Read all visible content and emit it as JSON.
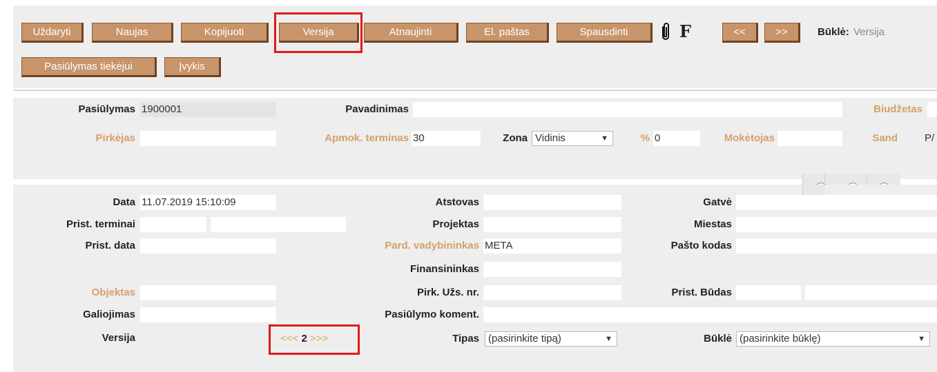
{
  "toolbar": {
    "close": "Uždaryti",
    "new": "Naujas",
    "copy": "Kopijuoti",
    "version": "Versija",
    "refresh": "Atnaujinti",
    "email": "El. paštas",
    "print": "Spausdinti",
    "attach_icon": "paperclip-icon",
    "f_label": "F",
    "prev": "<<",
    "next": ">>",
    "status_label": "Būklė:",
    "status_value": "Versija",
    "supplier_offer": "Pasiūlymas tiekėjui",
    "event": "Įvykis"
  },
  "header": {
    "offer_label": "Pasiūlymas",
    "offer_value": "1900001",
    "name_label": "Pavadinimas",
    "name_value": "",
    "budget_label": "Biudžetas",
    "buyer_label": "Pirkėjas",
    "buyer_value": "",
    "payment_terms_label": "Apmok. terminas",
    "payment_terms_value": "30",
    "zone_label": "Zona",
    "zone_value": "Vidinis",
    "percent_label": "%",
    "percent_value": "0",
    "payer_label": "Mokėtojas",
    "payer_value": "",
    "warehouse_label": "Sand",
    "warehouse_value": "P/"
  },
  "details": {
    "date_label": "Data",
    "date_value": "11.07.2019 15:10:09",
    "delivery_terms_label": "Prist. terminai",
    "delivery_date_label": "Prist. data",
    "object_label": "Objektas",
    "validity_label": "Galiojimas",
    "version_label": "Versija",
    "version_nav_prev": "<<<",
    "version_nav_value": "2",
    "version_nav_next": ">>>",
    "agent_label": "Atstovas",
    "project_label": "Projektas",
    "sales_manager_label": "Pard. vadybininkas",
    "sales_manager_value": "META",
    "financier_label": "Finansininkas",
    "purchase_order_label": "Pirk. Užs. nr.",
    "offer_comment_label": "Pasiūlymo koment.",
    "type_label": "Tipas",
    "type_value": "(pasirinkite tipą)",
    "street_label": "Gatvė",
    "city_label": "Miestas",
    "postcode_label": "Pašto kodas",
    "delivery_method_label": "Prist. Būdas",
    "state_label": "Būklė",
    "state_value": "(pasirinkite būklę)"
  },
  "colors": {
    "button": "#c8946a",
    "link_label": "#d4a06a",
    "panel": "#eeeeee",
    "highlight": "#e01a1a"
  }
}
